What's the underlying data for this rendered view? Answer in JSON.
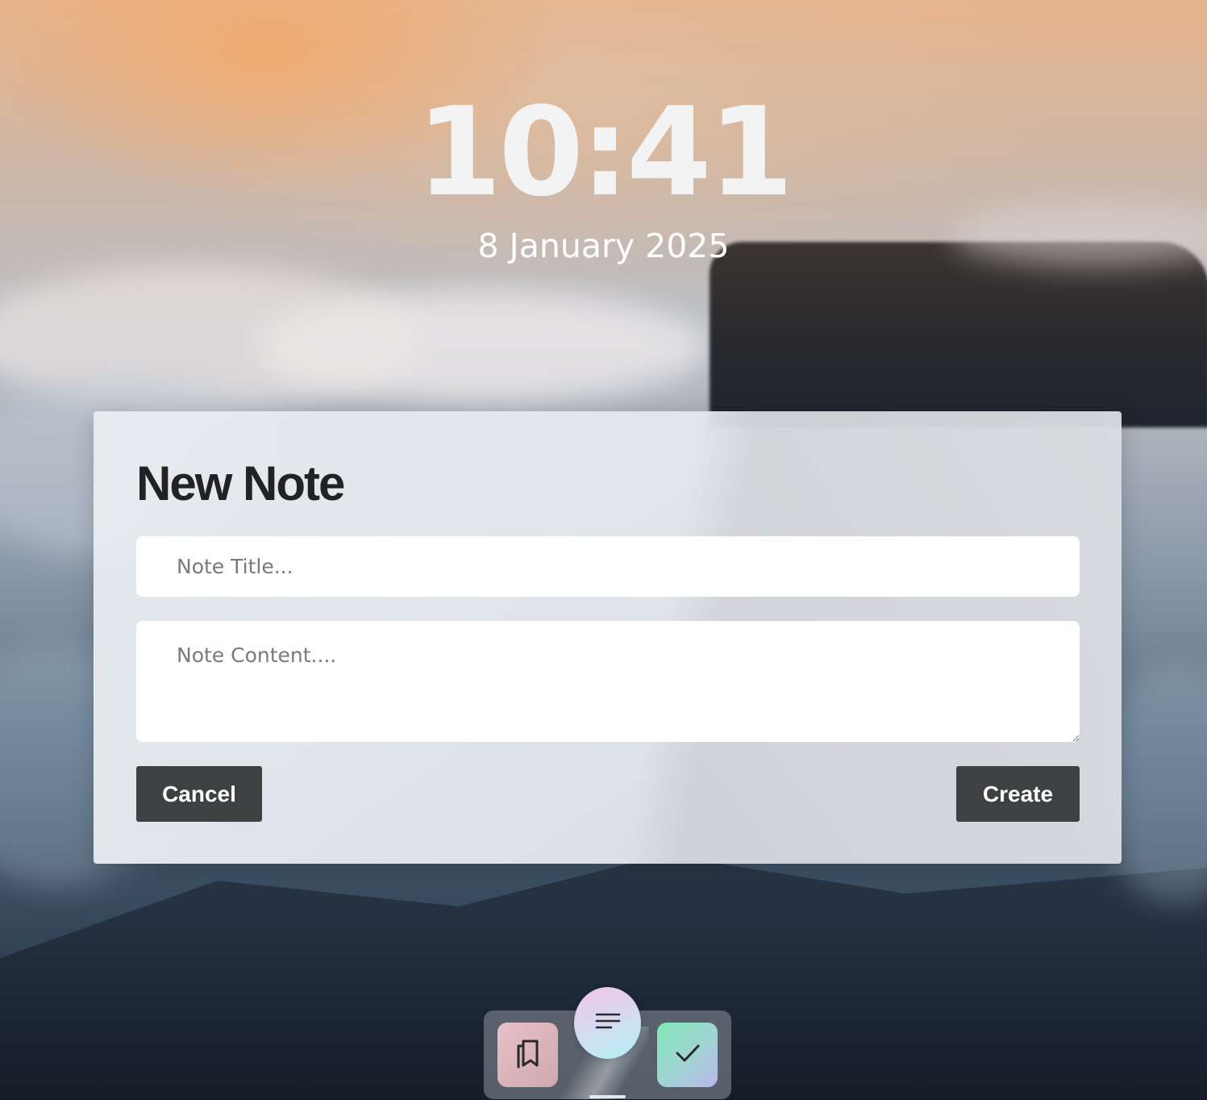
{
  "lock_screen": {
    "time": "10:41",
    "date": "8 January 2025"
  },
  "new_note_dialog": {
    "title": "New Note",
    "title_input": {
      "placeholder": "Note Title...",
      "value": ""
    },
    "content_input": {
      "placeholder": "Note Content....",
      "value": ""
    },
    "cancel_label": "Cancel",
    "create_label": "Create"
  },
  "dock": {
    "apps": [
      {
        "name": "Bookmarks",
        "icon": "bookmarks-icon"
      },
      {
        "name": "Notes",
        "icon": "lines-icon"
      },
      {
        "name": "Tasks",
        "icon": "checkmark-icon"
      }
    ]
  },
  "colors": {
    "button_background": "#3f4042",
    "button_text": "#ffffff",
    "title_text": "#222222"
  }
}
